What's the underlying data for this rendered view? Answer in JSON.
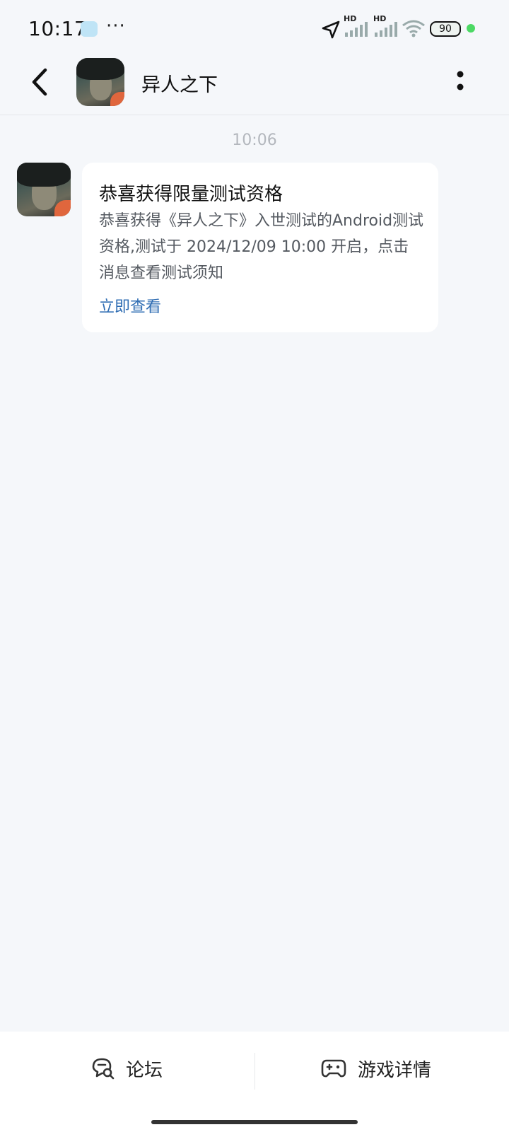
{
  "status_bar": {
    "time": "10:17",
    "dots": "···",
    "signal1_label": "HD",
    "signal2_label": "HD",
    "battery": "90",
    "icons": [
      "location-arrow-icon",
      "signal-icon",
      "signal-icon",
      "wifi-icon",
      "battery-icon",
      "dot-icon"
    ],
    "dot_color": "#4cd964"
  },
  "header": {
    "title": "异人之下",
    "back_icon": "chevron-left-icon",
    "more_icon": "more-vertical-icon"
  },
  "chat": {
    "timestamp": "10:06",
    "message": {
      "title": "恭喜获得限量测试资格",
      "body": "恭喜获得《异人之下》入世测试的Android测试资格,测试于 2024/12/09 10:00 开启，点击消息查看测试须知",
      "link": "立即查看"
    }
  },
  "bottom_bar": {
    "forum_label": "论坛",
    "forum_icon": "chat-search-icon",
    "details_label": "游戏详情",
    "details_icon": "gamepad-icon"
  },
  "colors": {
    "background": "#f5f7fa",
    "link": "#2f6db3",
    "bubble": "#ffffff"
  }
}
